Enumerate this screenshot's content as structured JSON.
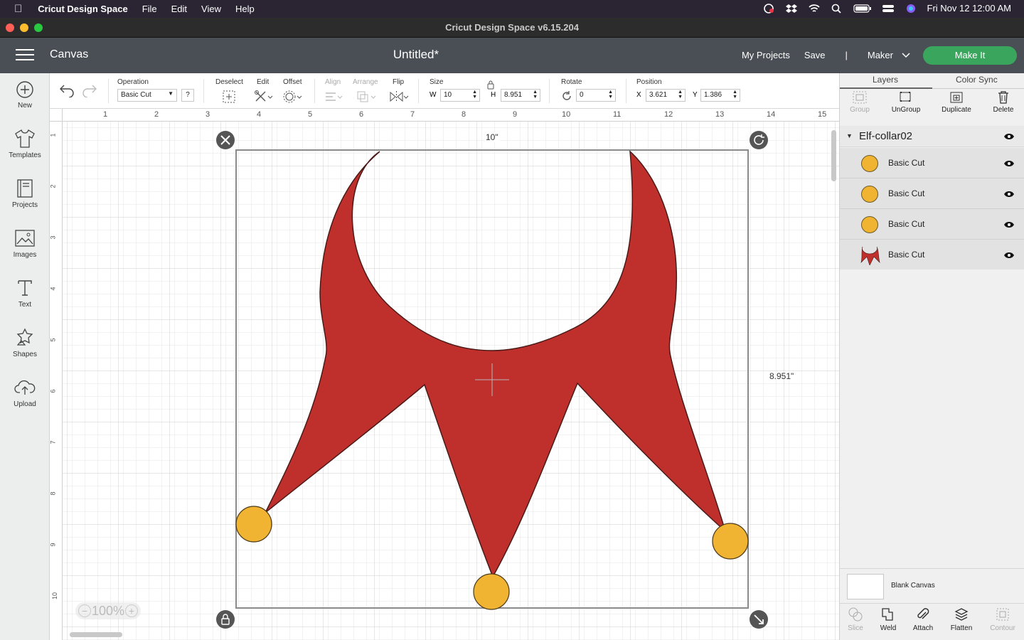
{
  "menubar": {
    "app_name": "Cricut Design Space",
    "items": [
      "File",
      "Edit",
      "View",
      "Help"
    ],
    "datetime": "Fri Nov 12  12:00 AM"
  },
  "window": {
    "title": "Cricut Design Space  v6.15.204"
  },
  "header": {
    "section": "Canvas",
    "doc_title": "Untitled*",
    "my_projects": "My Projects",
    "save": "Save",
    "divider": "|",
    "machine": "Maker",
    "make_it": "Make It"
  },
  "leftbar": {
    "items": [
      {
        "label": "New",
        "icon": "plus-circle-icon"
      },
      {
        "label": "Templates",
        "icon": "tshirt-icon"
      },
      {
        "label": "Projects",
        "icon": "projects-icon"
      },
      {
        "label": "Images",
        "icon": "image-icon"
      },
      {
        "label": "Text",
        "icon": "text-icon"
      },
      {
        "label": "Shapes",
        "icon": "shapes-icon"
      },
      {
        "label": "Upload",
        "icon": "upload-icon"
      }
    ]
  },
  "toolbar": {
    "operation_label": "Operation",
    "operation_value": "Basic Cut",
    "help": "?",
    "deselect": "Deselect",
    "edit": "Edit",
    "offset": "Offset",
    "align": "Align",
    "arrange": "Arrange",
    "flip": "Flip",
    "size_label": "Size",
    "w_label": "W",
    "w_value": "10",
    "h_label": "H",
    "h_value": "8.951",
    "rotate_label": "Rotate",
    "rotate_value": "0",
    "position_label": "Position",
    "x_label": "X",
    "x_value": "3.621",
    "y_label": "Y",
    "y_value": "1.386"
  },
  "canvas": {
    "ruler_top": [
      "1",
      "2",
      "3",
      "4",
      "5",
      "6",
      "7",
      "8",
      "9",
      "10",
      "11",
      "12",
      "13",
      "14",
      "15"
    ],
    "ruler_left": [
      "1",
      "2",
      "3",
      "4",
      "5",
      "6",
      "7",
      "8",
      "9",
      "10"
    ],
    "width_readout": "10\"",
    "height_readout": "8.951\"",
    "zoom": "100%",
    "zoom_minus": "−",
    "zoom_plus": "+",
    "collar_color": "#bf302d",
    "bell_color": "#f0b332"
  },
  "rightpanel": {
    "tabs": [
      "Layers",
      "Color Sync"
    ],
    "tools": [
      {
        "label": "Group",
        "disabled": true
      },
      {
        "label": "UnGroup",
        "disabled": false
      },
      {
        "label": "Duplicate",
        "disabled": false
      },
      {
        "label": "Delete",
        "disabled": false
      }
    ],
    "group_name": "Elf-collar02",
    "layers": [
      {
        "name": "Basic Cut",
        "type": "circle"
      },
      {
        "name": "Basic Cut",
        "type": "circle"
      },
      {
        "name": "Basic Cut",
        "type": "circle"
      },
      {
        "name": "Basic Cut",
        "type": "collar"
      }
    ],
    "blank_canvas": "Blank Canvas",
    "bottom_tools": [
      {
        "label": "Slice",
        "disabled": true
      },
      {
        "label": "Weld",
        "disabled": false
      },
      {
        "label": "Attach",
        "disabled": false
      },
      {
        "label": "Flatten",
        "disabled": false
      },
      {
        "label": "Contour",
        "disabled": true
      }
    ]
  }
}
